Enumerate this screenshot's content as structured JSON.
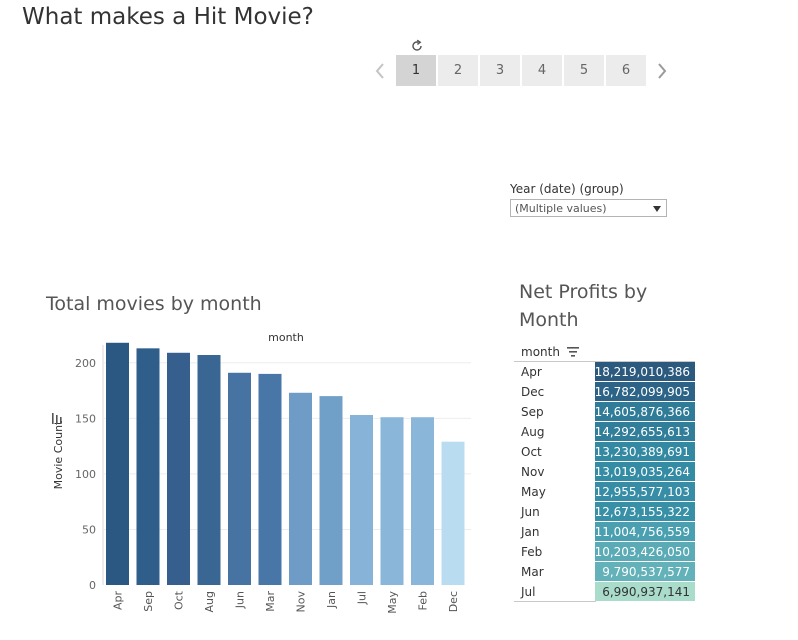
{
  "dashboard": {
    "title": "What makes a Hit Movie?"
  },
  "pager": {
    "reset_icon": "reset-icon",
    "prev_icon": "chevron-left-icon",
    "next_icon": "chevron-right-icon",
    "pages": [
      "1",
      "2",
      "3",
      "4",
      "5",
      "6"
    ],
    "active": "1"
  },
  "filter": {
    "label": "Year (date) (group)",
    "value": "(Multiple values)",
    "arrow_icon": "dropdown-arrow-icon"
  },
  "chart_data": {
    "type": "bar",
    "title": "Total movies by month",
    "header": "month",
    "ylabel": "Movie Count",
    "categories": [
      "Apr",
      "Sep",
      "Oct",
      "Aug",
      "Jun",
      "Mar",
      "Nov",
      "Jan",
      "Jul",
      "May",
      "Feb",
      "Dec"
    ],
    "values": [
      218,
      213,
      209,
      207,
      191,
      190,
      173,
      170,
      153,
      151,
      151,
      129
    ],
    "yticks": [
      0,
      50,
      100,
      150,
      200
    ],
    "ylim": [
      0,
      225
    ],
    "grid": true,
    "colors": [
      "#2b5882",
      "#2f5e8a",
      "#365f8d",
      "#3a6693",
      "#4773a3",
      "#4876a6",
      "#6e9cc6",
      "#709fc8",
      "#87b3d8",
      "#8ab6da",
      "#8ab6da",
      "#b9dcf0"
    ],
    "sort_icon": "sort-descending-icon"
  },
  "profits_table": {
    "title": "Net Profits by Month",
    "header": "month",
    "sort_icon": "sort-descending-icon",
    "rows": [
      {
        "month": "Apr",
        "value": "18,219,010,386",
        "bg": "#2b5a7e",
        "fg": "#ffffff"
      },
      {
        "month": "Dec",
        "value": "16,782,099,905",
        "bg": "#2c6386",
        "fg": "#ffffff"
      },
      {
        "month": "Sep",
        "value": "14,605,876,366",
        "bg": "#2f7b98",
        "fg": "#ffffff"
      },
      {
        "month": "Aug",
        "value": "14,292,655,613",
        "bg": "#307e9a",
        "fg": "#ffffff"
      },
      {
        "month": "Oct",
        "value": "13,230,389,691",
        "bg": "#3388a2",
        "fg": "#ffffff"
      },
      {
        "month": "Nov",
        "value": "13,019,035,264",
        "bg": "#348ba4",
        "fg": "#ffffff"
      },
      {
        "month": "May",
        "value": "12,955,577,103",
        "bg": "#368da5",
        "fg": "#ffffff"
      },
      {
        "month": "Jun",
        "value": "12,673,155,322",
        "bg": "#3890a7",
        "fg": "#ffffff"
      },
      {
        "month": "Jan",
        "value": "11,004,756,559",
        "bg": "#4aa0b0",
        "fg": "#ffffff"
      },
      {
        "month": "Feb",
        "value": "10,203,426,050",
        "bg": "#5aabb6",
        "fg": "#ffffff"
      },
      {
        "month": "Mar",
        "value": "9,790,537,577",
        "bg": "#63b1b9",
        "fg": "#ffffff"
      },
      {
        "month": "Jul",
        "value": "6,990,937,141",
        "bg": "#a9dccb",
        "fg": "#333333"
      }
    ]
  }
}
